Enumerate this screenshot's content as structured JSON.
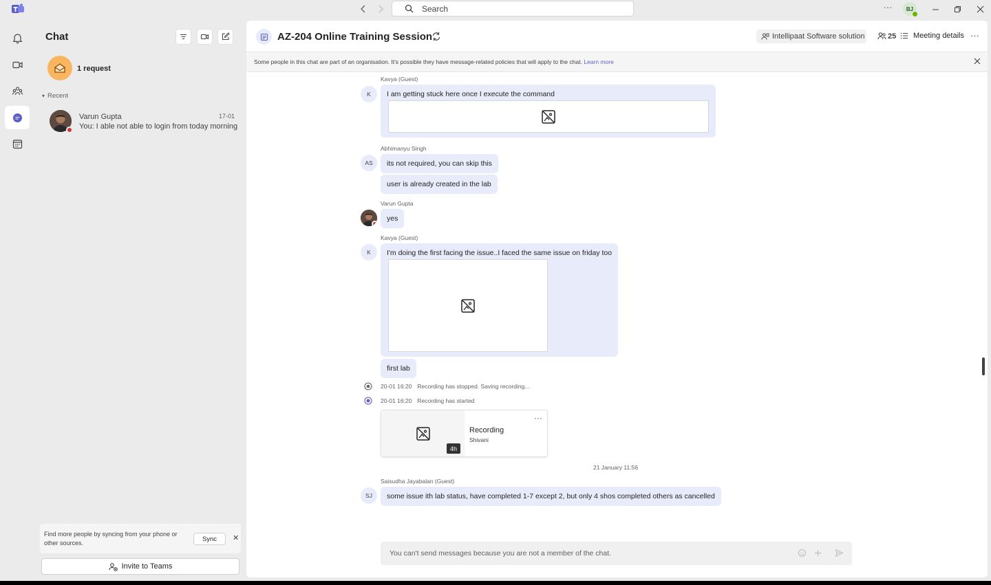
{
  "titlebar": {
    "search_placeholder": "Search",
    "more_label": "···",
    "user_initials": "BJ"
  },
  "rail": {
    "items": [
      {
        "icon": "bell-icon",
        "name": "Activity"
      },
      {
        "icon": "video-camera-icon",
        "name": "Meet"
      },
      {
        "icon": "people-community-icon",
        "name": "Communities"
      },
      {
        "icon": "chat-bubble-icon",
        "name": "Chat",
        "active": true
      },
      {
        "icon": "calendar-icon",
        "name": "Calendar"
      }
    ]
  },
  "chatlist": {
    "title": "Chat",
    "request_label": "1 request",
    "recent_label": "Recent",
    "items": [
      {
        "name": "Varun Gupta",
        "time": "17-01",
        "preview": "You: I able not able to login from today morning"
      }
    ],
    "sync_text": "Find more people by syncing from your phone or other sources.",
    "sync_button": "Sync",
    "invite_button": "Invite to Teams"
  },
  "conversation": {
    "title": "AZ-204 Online Training Session",
    "org_label": "Intellipaat Software solution",
    "participant_count": "25",
    "meeting_details_label": "Meeting details",
    "banner_text": "Some people in this chat are part of an organisation. It's possible they have message-related policies that will apply to the chat.",
    "banner_link": "Learn more",
    "messages": [
      {
        "sender": "Kavya (Guest)",
        "initials": "K",
        "text": "I am getting stuck here once I execute the command"
      },
      {
        "sender": "Abhimanyu Singh",
        "initials": "AS",
        "text": "its not required, you can skip this",
        "text2": "user is already created in the lab"
      },
      {
        "sender": "Varun Gupta",
        "text": "yes"
      },
      {
        "sender": "Kavya (Guest)",
        "initials": "K",
        "text": "I'm doing the first facing the issue..I faced the same issue on friday too",
        "text2": "first lab"
      },
      {
        "sender": "Saisudha Jayabalan (Guest)",
        "initials": "SJ",
        "text": "some issue ith lab status,  have completed 1-7 except 2, but only 4 shos completed others as cancelled"
      }
    ],
    "events": [
      {
        "when": "20-01 16:20",
        "text": "Recording has stopped. Saving recording..."
      },
      {
        "when": "20-01 16:20",
        "text": "Recording has started"
      }
    ],
    "recording": {
      "title": "Recording",
      "owner": "Shivani",
      "duration": "4h"
    },
    "date_divider": "21 January 11:56",
    "composer_text": "You can't send messages because you are not a member of the chat."
  },
  "colors": {
    "accent": "#5b5fc7",
    "bubble": "#e8ebfa",
    "request_orange": "#f9b55f",
    "presence_red": "#d13438",
    "presence_green": "#6bb700"
  }
}
